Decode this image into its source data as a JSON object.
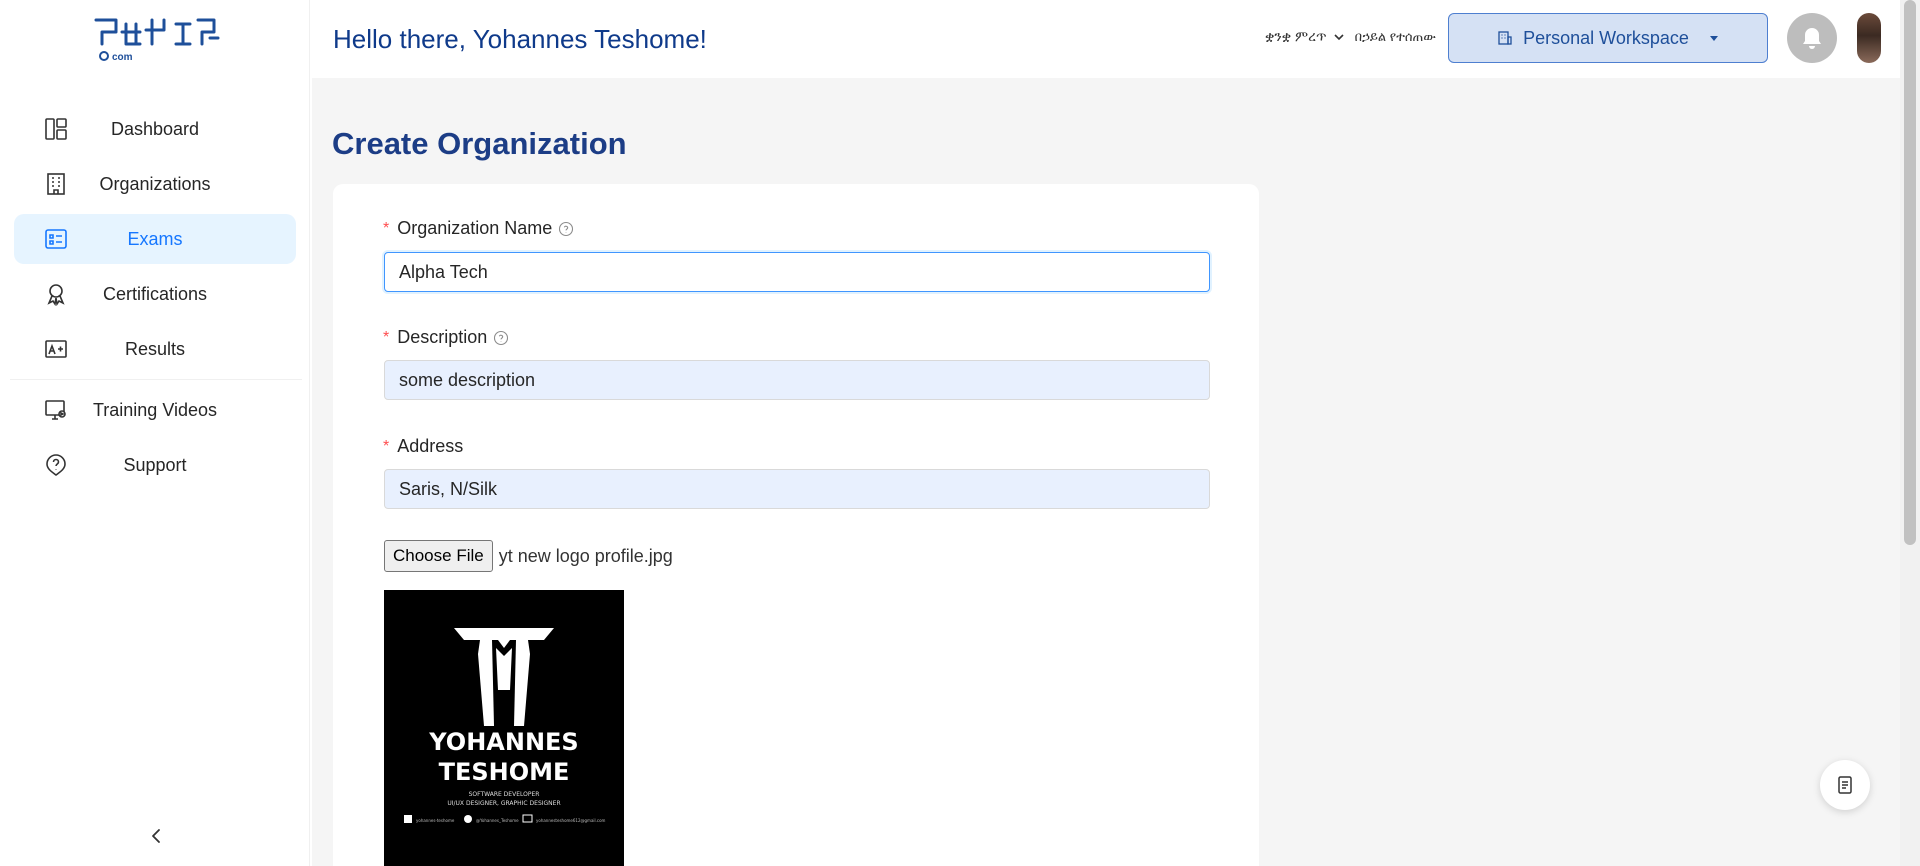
{
  "app": {
    "logo_text": "ፈተና.com",
    "logo_icon": "brand-logo-icon"
  },
  "sidebar": {
    "items": [
      {
        "label": "Dashboard",
        "icon": "dashboard-icon",
        "active": false
      },
      {
        "label": "Organizations",
        "icon": "building-icon",
        "active": false
      },
      {
        "label": "Exams",
        "icon": "exam-list-icon",
        "active": true
      },
      {
        "label": "Certifications",
        "icon": "award-icon",
        "active": false
      },
      {
        "label": "Results",
        "icon": "grade-icon",
        "active": false
      }
    ],
    "secondary_items": [
      {
        "label": "Training Videos",
        "icon": "video-tutorial-icon"
      },
      {
        "label": "Support",
        "icon": "help-circle-icon"
      }
    ],
    "collapse_icon": "chevron-left-icon"
  },
  "header": {
    "greeting": "Hello there, Yohannes Teshome!",
    "language": "ቋንቋ ምረጥ",
    "language_secondary": "በኃይል የተሰጠው",
    "workspace_label": "Personal Workspace",
    "bell_icon": "bell-icon"
  },
  "page": {
    "title": "Create Organization"
  },
  "form": {
    "org_name": {
      "label": "Organization Name",
      "value": "Alpha Tech"
    },
    "description": {
      "label": "Description",
      "value": "some description"
    },
    "address": {
      "label": "Address",
      "value": "Saris, N/Silk"
    },
    "file": {
      "button_label": "Choose File",
      "file_name": "yt new logo profile.jpg"
    },
    "preview": {
      "line1": "YOHANNES",
      "line2": "TESHOME",
      "line3": "SOFTWARE DEVELOPER",
      "line4": "UI/UX DESIGNER, GRAPHIC DESIGNER",
      "contact1": "yohannes-teshome",
      "contact2": "@Yohannes_Teshome",
      "contact3": "yohannesteshome612@gmail.com"
    }
  },
  "colors": {
    "primary": "#1677ff",
    "title": "#1c3d86",
    "active_bg": "#e6f4ff",
    "required": "#ff4d4f",
    "input_filled": "#e8f0fe",
    "workspace_bg": "#d5e1f4"
  }
}
